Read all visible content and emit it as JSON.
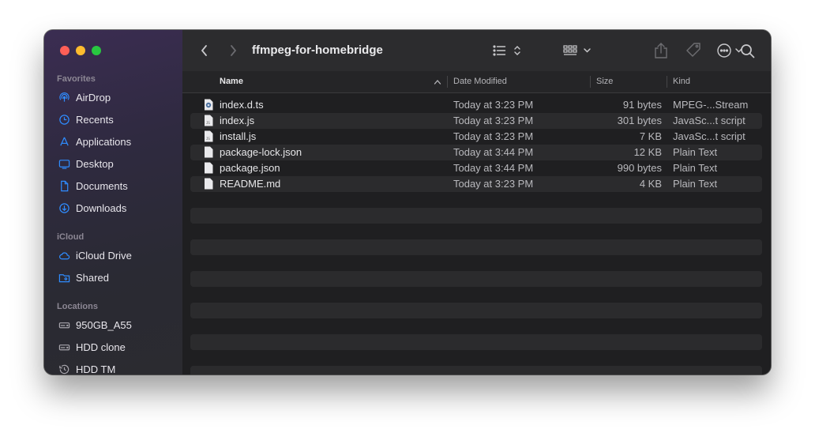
{
  "window": {
    "title": "ffmpeg-for-homebridge"
  },
  "sidebar": {
    "sections": [
      {
        "title": "Favorites",
        "items": [
          {
            "label": "AirDrop",
            "icon": "airdrop-icon"
          },
          {
            "label": "Recents",
            "icon": "clock-icon"
          },
          {
            "label": "Applications",
            "icon": "applications-icon"
          },
          {
            "label": "Desktop",
            "icon": "desktop-icon"
          },
          {
            "label": "Documents",
            "icon": "document-icon"
          },
          {
            "label": "Downloads",
            "icon": "download-icon"
          }
        ]
      },
      {
        "title": "iCloud",
        "items": [
          {
            "label": "iCloud Drive",
            "icon": "cloud-icon"
          },
          {
            "label": "Shared",
            "icon": "shared-folder-icon"
          }
        ]
      },
      {
        "title": "Locations",
        "items": [
          {
            "label": "950GB_A55",
            "icon": "disk-icon"
          },
          {
            "label": "HDD clone",
            "icon": "disk-icon"
          },
          {
            "label": "HDD TM",
            "icon": "time-machine-icon"
          }
        ]
      }
    ]
  },
  "columns": {
    "name": "Name",
    "date": "Date Modified",
    "size": "Size",
    "kind": "Kind"
  },
  "files": [
    {
      "name": "index.d.ts",
      "date": "Today at 3:23 PM",
      "size": "91 bytes",
      "kind": "MPEG-...Stream"
    },
    {
      "name": "index.js",
      "date": "Today at 3:23 PM",
      "size": "301 bytes",
      "kind": "JavaSc...t script"
    },
    {
      "name": "install.js",
      "date": "Today at 3:23 PM",
      "size": "7 KB",
      "kind": "JavaSc...t script"
    },
    {
      "name": "package-lock.json",
      "date": "Today at 3:44 PM",
      "size": "12 KB",
      "kind": "Plain Text"
    },
    {
      "name": "package.json",
      "date": "Today at 3:44 PM",
      "size": "990 bytes",
      "kind": "Plain Text"
    },
    {
      "name": "README.md",
      "date": "Today at 3:23 PM",
      "size": "4 KB",
      "kind": "Plain Text"
    }
  ],
  "colors": {
    "accent": "#2f8cff",
    "sidebar_tint": "#3b2d52"
  }
}
